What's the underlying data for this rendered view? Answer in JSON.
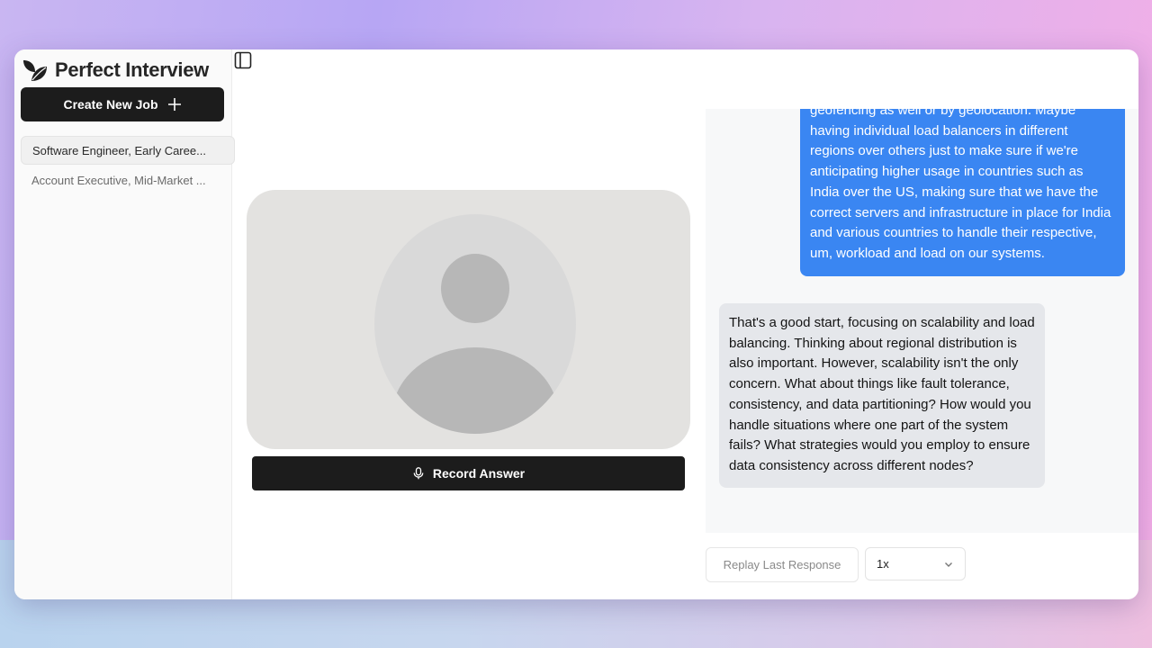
{
  "brand": {
    "name": "Perfect Interview",
    "logo_icon": "leaf-icon"
  },
  "sidebar": {
    "create_button_label": "Create New Job",
    "jobs": [
      {
        "label": "Software Engineer, Early Caree...",
        "active": true
      },
      {
        "label": "Account Executive, Mid-Market ...",
        "active": false
      }
    ]
  },
  "video": {
    "placeholder_icon": "user-avatar-icon"
  },
  "record_button": {
    "label": "Record Answer",
    "icon": "microphone-icon"
  },
  "chat": {
    "user_message": "geofencing as well or by geolocation. Maybe having individual load balancers in different regions over others just to make sure if we're anticipating higher usage in countries such as India over the US, making sure that we have the correct servers and infrastructure in place for India and various countries to handle their respective, um, workload and load on our systems.",
    "ai_message": "That's a good start, focusing on scalability and load balancing. Thinking about regional distribution is also important. However, scalability isn't the only concern. What about things like fault tolerance, consistency, and data partitioning? How would you handle situations where one part of the system fails? What strategies would you employ to ensure data consistency across different nodes?"
  },
  "controls": {
    "replay_label": "Replay Last Response",
    "speed_value": "1x"
  },
  "colors": {
    "primary_dark": "#1c1c1c",
    "user_bubble": "#3a86f2",
    "ai_bubble": "#e5e7eb"
  }
}
